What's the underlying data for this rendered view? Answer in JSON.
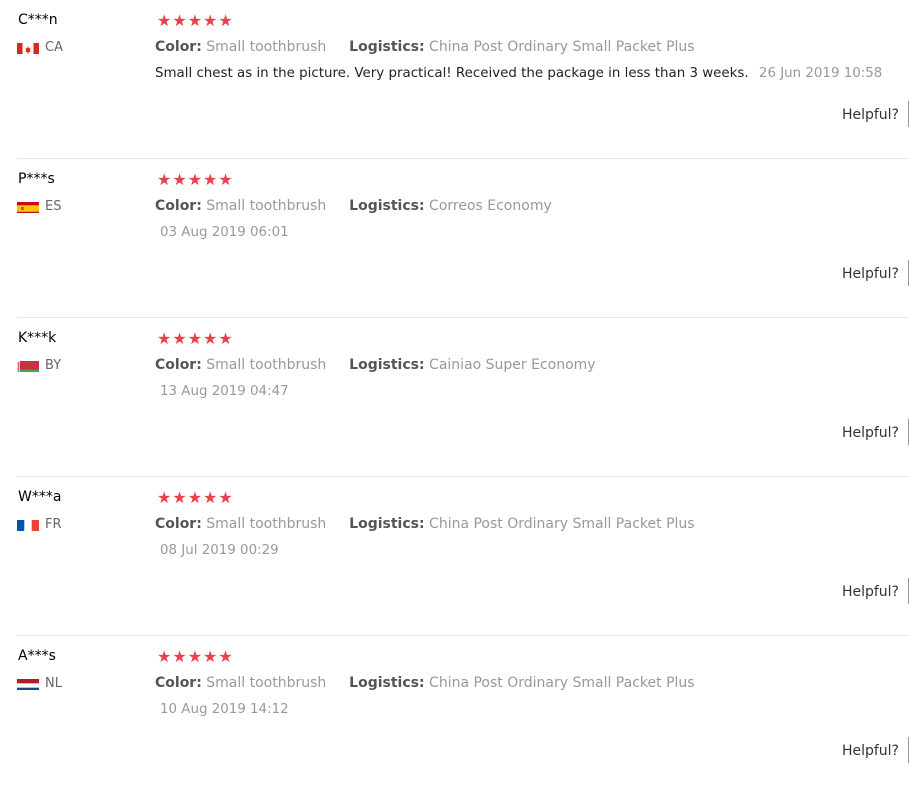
{
  "reviews": [
    {
      "name": "C***n",
      "country": "CA",
      "flag": "ca",
      "rating": 5,
      "color_label": "Color:",
      "color_value": "Small toothbrush",
      "logistics_label": "Logistics:",
      "logistics_value": "China Post Ordinary Small Packet Plus",
      "text": "Small chest as in the picture. Very practical! Received the package in less than 3 weeks.",
      "date": "26 Jun 2019 10:58",
      "helpful": "Helpful?"
    },
    {
      "name": "P***s",
      "country": "ES",
      "flag": "es",
      "rating": 5,
      "color_label": "Color:",
      "color_value": "Small toothbrush",
      "logistics_label": "Logistics:",
      "logistics_value": "Correos Economy",
      "text": "",
      "date": "03 Aug 2019 06:01",
      "helpful": "Helpful?"
    },
    {
      "name": "K***k",
      "country": "BY",
      "flag": "by",
      "rating": 5,
      "color_label": "Color:",
      "color_value": "Small toothbrush",
      "logistics_label": "Logistics:",
      "logistics_value": "Cainiao Super Economy",
      "text": "",
      "date": "13 Aug 2019 04:47",
      "helpful": "Helpful?"
    },
    {
      "name": "W***a",
      "country": "FR",
      "flag": "fr",
      "rating": 5,
      "color_label": "Color:",
      "color_value": "Small toothbrush",
      "logistics_label": "Logistics:",
      "logistics_value": "China Post Ordinary Small Packet Plus",
      "text": "",
      "date": "08 Jul 2019 00:29",
      "helpful": "Helpful?"
    },
    {
      "name": "A***s",
      "country": "NL",
      "flag": "nl",
      "rating": 5,
      "color_label": "Color:",
      "color_value": "Small toothbrush",
      "logistics_label": "Logistics:",
      "logistics_value": "China Post Ordinary Small Packet Plus",
      "text": "",
      "date": "10 Aug 2019 14:12",
      "helpful": "Helpful?"
    }
  ],
  "colors": {
    "star": "#e8424a",
    "label": "#555555",
    "muted": "#999999"
  }
}
